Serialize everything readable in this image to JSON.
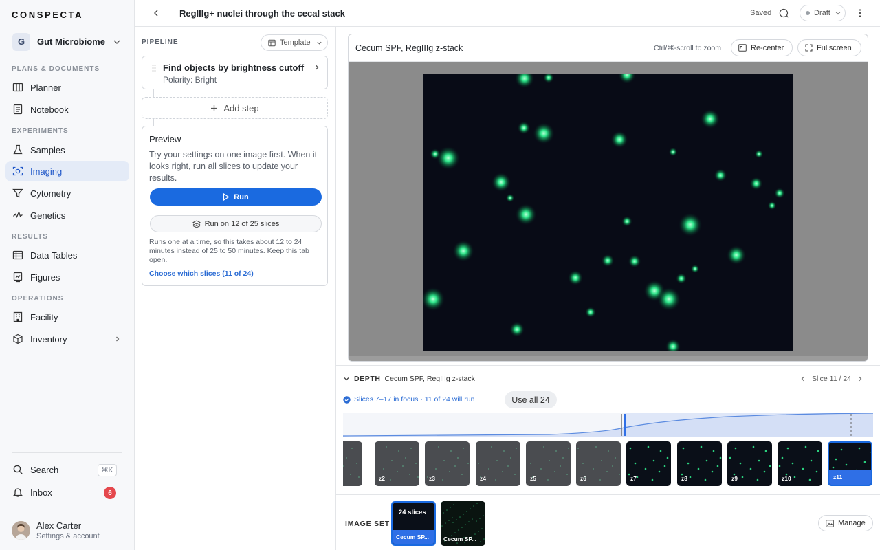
{
  "sidebar": {
    "brand": "CONSPECTA",
    "workspace": {
      "initial": "G",
      "name": "Gut Microbiome Lab"
    },
    "sections": {
      "plans": "PLANS & DOCUMENTS",
      "experiments": "EXPERIMENTS",
      "results": "RESULTS",
      "operations": "OPERATIONS"
    },
    "items": {
      "planner": "Planner",
      "notebook": "Notebook",
      "samples": "Samples",
      "imaging": "Imaging",
      "cytometry": "Cytometry",
      "genetics": "Genetics",
      "data_tables": "Data Tables",
      "figures": "Figures",
      "facility": "Facility",
      "inventory": "Inventory"
    },
    "search": {
      "label": "Search",
      "shortcut": "⌘K"
    },
    "inbox": {
      "label": "Inbox",
      "count": "6"
    },
    "user": {
      "name": "Alex Carter",
      "sub": "Settings & account"
    }
  },
  "topbar": {
    "title": "RegIIIg+ nuclei through the cecal stack",
    "saved": "Saved",
    "status": "Draft"
  },
  "pipeline": {
    "label": "PIPELINE",
    "template": "Template",
    "step": {
      "title": "Find objects by brightness cutoff",
      "sub": "Polarity: Bright"
    },
    "add_step": "Add step",
    "preview": {
      "title": "Preview",
      "desc": "Try your settings on one image first. When it looks right, run all slices to update your results.",
      "run": "Run",
      "run_subset": "Run on 12 of 25 slices",
      "note": "Runs one at a time, so this takes about 12 to 24 minutes instead of 25 to 50 minutes. Keep this tab open.",
      "link": "Choose which slices (11 of 24)"
    }
  },
  "viewer": {
    "title": "Cecum SPF, RegIIIg z-stack",
    "hint": "Ctrl/⌘-scroll to zoom",
    "recenter": "Re-center",
    "fullscreen": "Fullscreen"
  },
  "depth": {
    "label": "DEPTH",
    "stack": "Cecum SPF, RegIIIg z-stack",
    "slice": "Slice 11 / 24",
    "focus": "Slices 7–17 in focus · 11 of 24 will run",
    "use_all": "Use all 24",
    "thumbs": [
      "",
      "z2",
      "z3",
      "z4",
      "z5",
      "z6",
      "z7",
      "z8",
      "z9",
      "z10",
      "z11"
    ]
  },
  "image_set": {
    "label": "IMAGE SET",
    "cards": [
      {
        "top": "24 slices",
        "name": "Cecum SP..."
      },
      {
        "top": "",
        "name": "Cecum SP..."
      }
    ],
    "manage": "Manage"
  },
  "colors": {
    "accent": "#1a6ae0",
    "active_bg": "#e4ebf7",
    "badge": "#e5484d",
    "spot": "#2ee58a"
  }
}
